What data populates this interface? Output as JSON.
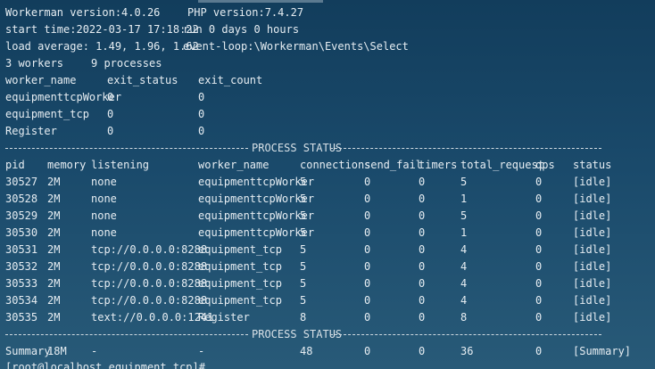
{
  "header": {
    "workerman_version": "Workerman version:4.0.26",
    "php_version": "PHP version:7.4.27",
    "start_time": "start time:2022-03-17 17:18:22",
    "run_time": "run 0 days 0 hours",
    "load_average": "load average: 1.49, 1.96, 1.62",
    "event_loop": "event-loop:\\Workerman\\Events\\Select",
    "workers": "3 workers",
    "processes": "9 processes"
  },
  "worker_table": {
    "headers": [
      "worker_name",
      "exit_status",
      "exit_count"
    ],
    "rows": [
      [
        "equipmenttcpWorker",
        "0",
        "0"
      ],
      [
        "equipment_tcp",
        "0",
        "0"
      ],
      [
        "Register",
        "0",
        "0"
      ]
    ]
  },
  "process_status_label": "PROCESS STATUS",
  "process_table": {
    "headers": [
      "pid",
      "memory",
      "listening",
      "worker_name",
      "connections",
      "send_fail",
      "timers",
      "total_request",
      "qps",
      "status"
    ],
    "rows": [
      [
        "30527",
        "2M",
        "none",
        "equipmenttcpWorker",
        "5",
        "0",
        "0",
        "5",
        "0",
        "[idle]"
      ],
      [
        "30528",
        "2M",
        "none",
        "equipmenttcpWorker",
        "5",
        "0",
        "0",
        "1",
        "0",
        "[idle]"
      ],
      [
        "30529",
        "2M",
        "none",
        "equipmenttcpWorker",
        "5",
        "0",
        "0",
        "5",
        "0",
        "[idle]"
      ],
      [
        "30530",
        "2M",
        "none",
        "equipmenttcpWorker",
        "5",
        "0",
        "0",
        "1",
        "0",
        "[idle]"
      ],
      [
        "30531",
        "2M",
        "tcp://0.0.0.0:8288",
        "equipment_tcp",
        "5",
        "0",
        "0",
        "4",
        "0",
        "[idle]"
      ],
      [
        "30532",
        "2M",
        "tcp://0.0.0.0:8288",
        "equipment_tcp",
        "5",
        "0",
        "0",
        "4",
        "0",
        "[idle]"
      ],
      [
        "30533",
        "2M",
        "tcp://0.0.0.0:8288",
        "equipment_tcp",
        "5",
        "0",
        "0",
        "4",
        "0",
        "[idle]"
      ],
      [
        "30534",
        "2M",
        "tcp://0.0.0.0:8288",
        "equipment_tcp",
        "5",
        "0",
        "0",
        "4",
        "0",
        "[idle]"
      ],
      [
        "30535",
        "2M",
        "text://0.0.0.0:1241",
        "Register",
        "8",
        "0",
        "0",
        "8",
        "0",
        "[idle]"
      ]
    ],
    "summary": [
      "Summary",
      "18M",
      "-",
      "-",
      "48",
      "0",
      "0",
      "36",
      "0",
      "[Summary]"
    ]
  },
  "prompt": "[root@localhost equipment_tcp]#"
}
